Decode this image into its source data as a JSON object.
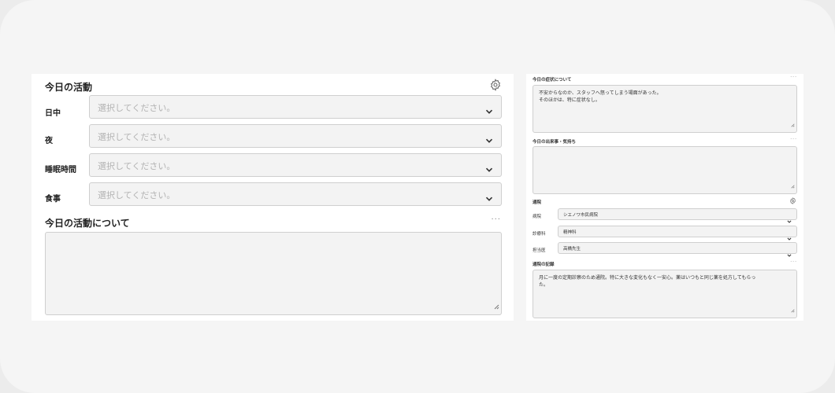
{
  "left_panel": {
    "title": "今日の活動",
    "fields": [
      {
        "label": "日中",
        "placeholder": "選択してください。"
      },
      {
        "label": "夜",
        "placeholder": "選択してください。"
      },
      {
        "label": "睡眠時間",
        "placeholder": "選択してください。"
      },
      {
        "label": "食事",
        "placeholder": "選択してください。"
      }
    ],
    "notes_title": "今日の活動について",
    "more_label": "···",
    "notes_value": ""
  },
  "right_panel": {
    "symptoms": {
      "label": "今日の症状について",
      "more_label": "···",
      "line1": "不安からなのか、スタッフへ怒ってしまう場面があった。",
      "line2": "そのほかは、特に症状なし。"
    },
    "events": {
      "label": "今日の出来事・気持ち",
      "more_label": "···",
      "value": ""
    },
    "hospital": {
      "title": "通院",
      "fields": [
        {
          "label": "病院",
          "value": "シエノワ市民病院"
        },
        {
          "label": "診療科",
          "value": "精神科"
        },
        {
          "label": "担当医",
          "value": "高橋先生"
        }
      ]
    },
    "visit_record": {
      "label": "通院の記録",
      "more_label": "···",
      "line1": "月に一度の定期診察のため通院。特に大きな変化もなく一安心。薬はいつもと同じ薬を処方してもらっ",
      "line2": "た。"
    }
  }
}
